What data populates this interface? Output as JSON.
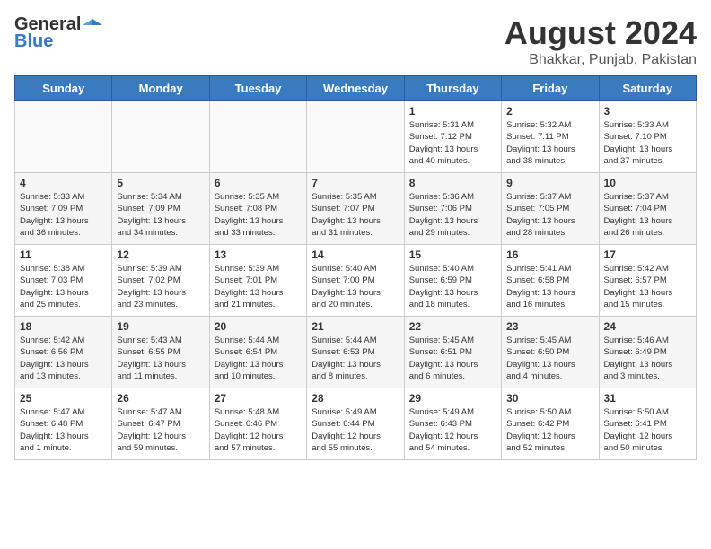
{
  "header": {
    "logo_general": "General",
    "logo_blue": "Blue",
    "month_title": "August 2024",
    "location": "Bhakkar, Punjab, Pakistan"
  },
  "calendar": {
    "days_of_week": [
      "Sunday",
      "Monday",
      "Tuesday",
      "Wednesday",
      "Thursday",
      "Friday",
      "Saturday"
    ],
    "weeks": [
      [
        {
          "day": "",
          "info": ""
        },
        {
          "day": "",
          "info": ""
        },
        {
          "day": "",
          "info": ""
        },
        {
          "day": "",
          "info": ""
        },
        {
          "day": "1",
          "info": "Sunrise: 5:31 AM\nSunset: 7:12 PM\nDaylight: 13 hours\nand 40 minutes."
        },
        {
          "day": "2",
          "info": "Sunrise: 5:32 AM\nSunset: 7:11 PM\nDaylight: 13 hours\nand 38 minutes."
        },
        {
          "day": "3",
          "info": "Sunrise: 5:33 AM\nSunset: 7:10 PM\nDaylight: 13 hours\nand 37 minutes."
        }
      ],
      [
        {
          "day": "4",
          "info": "Sunrise: 5:33 AM\nSunset: 7:09 PM\nDaylight: 13 hours\nand 36 minutes."
        },
        {
          "day": "5",
          "info": "Sunrise: 5:34 AM\nSunset: 7:09 PM\nDaylight: 13 hours\nand 34 minutes."
        },
        {
          "day": "6",
          "info": "Sunrise: 5:35 AM\nSunset: 7:08 PM\nDaylight: 13 hours\nand 33 minutes."
        },
        {
          "day": "7",
          "info": "Sunrise: 5:35 AM\nSunset: 7:07 PM\nDaylight: 13 hours\nand 31 minutes."
        },
        {
          "day": "8",
          "info": "Sunrise: 5:36 AM\nSunset: 7:06 PM\nDaylight: 13 hours\nand 29 minutes."
        },
        {
          "day": "9",
          "info": "Sunrise: 5:37 AM\nSunset: 7:05 PM\nDaylight: 13 hours\nand 28 minutes."
        },
        {
          "day": "10",
          "info": "Sunrise: 5:37 AM\nSunset: 7:04 PM\nDaylight: 13 hours\nand 26 minutes."
        }
      ],
      [
        {
          "day": "11",
          "info": "Sunrise: 5:38 AM\nSunset: 7:03 PM\nDaylight: 13 hours\nand 25 minutes."
        },
        {
          "day": "12",
          "info": "Sunrise: 5:39 AM\nSunset: 7:02 PM\nDaylight: 13 hours\nand 23 minutes."
        },
        {
          "day": "13",
          "info": "Sunrise: 5:39 AM\nSunset: 7:01 PM\nDaylight: 13 hours\nand 21 minutes."
        },
        {
          "day": "14",
          "info": "Sunrise: 5:40 AM\nSunset: 7:00 PM\nDaylight: 13 hours\nand 20 minutes."
        },
        {
          "day": "15",
          "info": "Sunrise: 5:40 AM\nSunset: 6:59 PM\nDaylight: 13 hours\nand 18 minutes."
        },
        {
          "day": "16",
          "info": "Sunrise: 5:41 AM\nSunset: 6:58 PM\nDaylight: 13 hours\nand 16 minutes."
        },
        {
          "day": "17",
          "info": "Sunrise: 5:42 AM\nSunset: 6:57 PM\nDaylight: 13 hours\nand 15 minutes."
        }
      ],
      [
        {
          "day": "18",
          "info": "Sunrise: 5:42 AM\nSunset: 6:56 PM\nDaylight: 13 hours\nand 13 minutes."
        },
        {
          "day": "19",
          "info": "Sunrise: 5:43 AM\nSunset: 6:55 PM\nDaylight: 13 hours\nand 11 minutes."
        },
        {
          "day": "20",
          "info": "Sunrise: 5:44 AM\nSunset: 6:54 PM\nDaylight: 13 hours\nand 10 minutes."
        },
        {
          "day": "21",
          "info": "Sunrise: 5:44 AM\nSunset: 6:53 PM\nDaylight: 13 hours\nand 8 minutes."
        },
        {
          "day": "22",
          "info": "Sunrise: 5:45 AM\nSunset: 6:51 PM\nDaylight: 13 hours\nand 6 minutes."
        },
        {
          "day": "23",
          "info": "Sunrise: 5:45 AM\nSunset: 6:50 PM\nDaylight: 13 hours\nand 4 minutes."
        },
        {
          "day": "24",
          "info": "Sunrise: 5:46 AM\nSunset: 6:49 PM\nDaylight: 13 hours\nand 3 minutes."
        }
      ],
      [
        {
          "day": "25",
          "info": "Sunrise: 5:47 AM\nSunset: 6:48 PM\nDaylight: 13 hours\nand 1 minute."
        },
        {
          "day": "26",
          "info": "Sunrise: 5:47 AM\nSunset: 6:47 PM\nDaylight: 12 hours\nand 59 minutes."
        },
        {
          "day": "27",
          "info": "Sunrise: 5:48 AM\nSunset: 6:46 PM\nDaylight: 12 hours\nand 57 minutes."
        },
        {
          "day": "28",
          "info": "Sunrise: 5:49 AM\nSunset: 6:44 PM\nDaylight: 12 hours\nand 55 minutes."
        },
        {
          "day": "29",
          "info": "Sunrise: 5:49 AM\nSunset: 6:43 PM\nDaylight: 12 hours\nand 54 minutes."
        },
        {
          "day": "30",
          "info": "Sunrise: 5:50 AM\nSunset: 6:42 PM\nDaylight: 12 hours\nand 52 minutes."
        },
        {
          "day": "31",
          "info": "Sunrise: 5:50 AM\nSunset: 6:41 PM\nDaylight: 12 hours\nand 50 minutes."
        }
      ]
    ]
  }
}
